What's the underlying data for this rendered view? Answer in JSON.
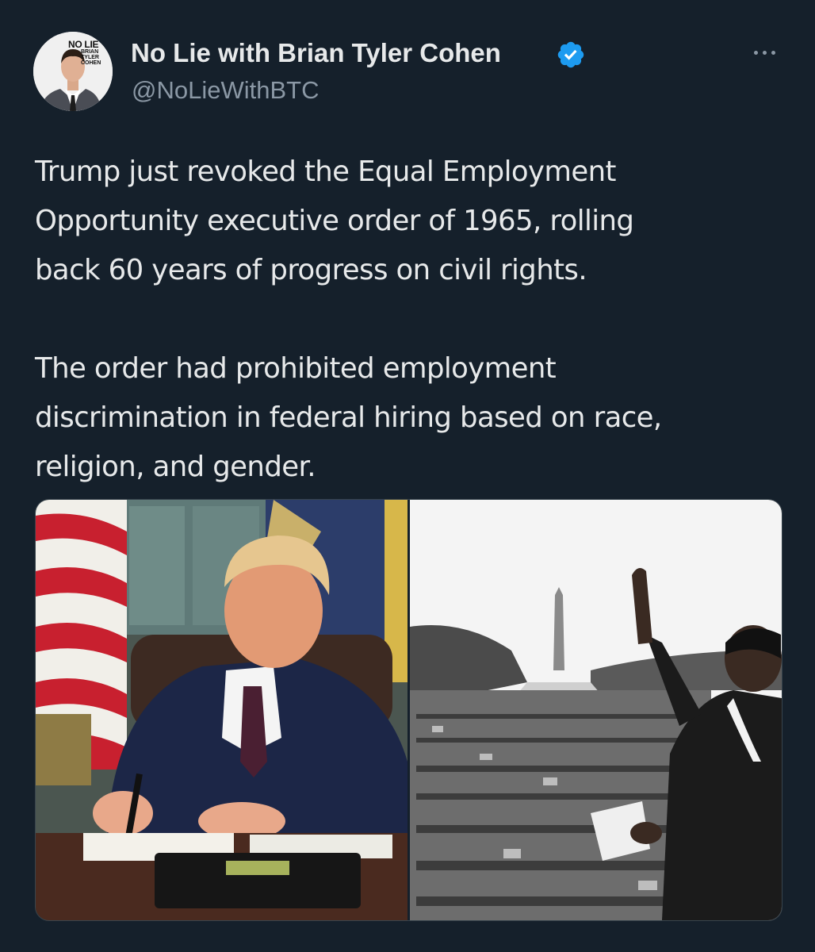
{
  "author": {
    "display_name": "No Lie with Brian Tyler Cohen",
    "handle": "@NoLieWithBTC",
    "avatar_text": [
      "NO LIE",
      "with",
      "BRIAN",
      "TYLER",
      "COHEN"
    ],
    "verified": true
  },
  "tweet": {
    "paragraphs": [
      "Trump just revoked the Equal Employment\nOpportunity executive order of 1965, rolling\nback 60 years of progress on civil rights.",
      "The order had prohibited employment\ndiscrimination in federal hiring based on race,\nreligion, and gender."
    ]
  },
  "media": {
    "images": [
      {
        "name": "president-signing-at-desk"
      },
      {
        "name": "civil-rights-march-crowd"
      }
    ]
  },
  "colors": {
    "background": "#15202b",
    "text": "#e7e9ea",
    "secondary_text": "#8b98a5",
    "verified_blue": "#1d9bf0"
  },
  "icons": {
    "verified": "verified-badge-icon",
    "more": "more-options-icon"
  }
}
